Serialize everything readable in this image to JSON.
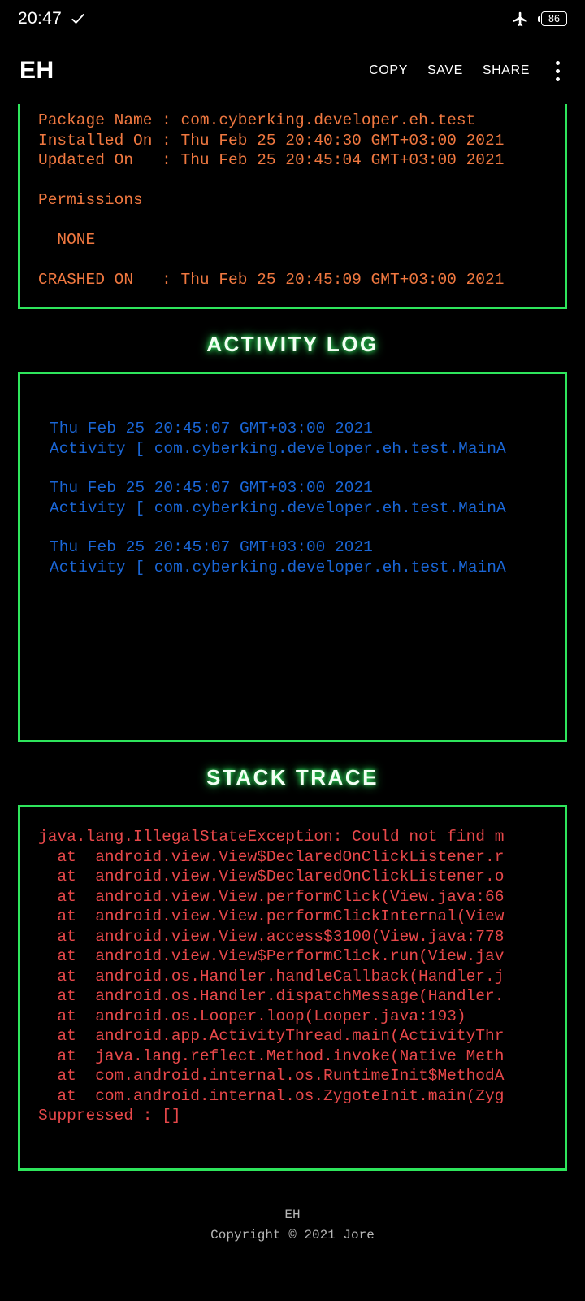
{
  "status_bar": {
    "clock": "20:47",
    "check_icon": "check-icon",
    "airplane_icon": "airplane-mode-icon",
    "battery_level": "86"
  },
  "app_bar": {
    "title": "EH",
    "actions": [
      {
        "label": "COPY",
        "name": "copy-button"
      },
      {
        "label": "SAVE",
        "name": "save-button"
      },
      {
        "label": "SHARE",
        "name": "share-button"
      }
    ],
    "overflow_icon": "overflow-menu-icon"
  },
  "info_panel": {
    "lines": [
      "Package Name : com.cyberking.developer.eh.test",
      "Installed On : Thu Feb 25 20:40:30 GMT+03:00 2021",
      "Updated On   : Thu Feb 25 20:45:04 GMT+03:00 2021"
    ],
    "permissions_label": "Permissions",
    "permissions_value": "  NONE",
    "crashed_line": "CRASHED ON   : Thu Feb 25 20:45:09 GMT+03:00 2021"
  },
  "activity_log": {
    "heading": "ACTIVITY LOG",
    "entries": [
      {
        "timestamp": "Thu Feb 25 20:45:07 GMT+03:00 2021",
        "detail": "Activity [ com.cyberking.developer.eh.test.MainA"
      },
      {
        "timestamp": "Thu Feb 25 20:45:07 GMT+03:00 2021",
        "detail": "Activity [ com.cyberking.developer.eh.test.MainA"
      },
      {
        "timestamp": "Thu Feb 25 20:45:07 GMT+03:00 2021",
        "detail": "Activity [ com.cyberking.developer.eh.test.MainA"
      }
    ]
  },
  "stack_trace": {
    "heading": "STACK TRACE",
    "lines": [
      "java.lang.IllegalStateException: Could not find m",
      "  at  android.view.View$DeclaredOnClickListener.r",
      "  at  android.view.View$DeclaredOnClickListener.o",
      "  at  android.view.View.performClick(View.java:66",
      "  at  android.view.View.performClickInternal(View",
      "  at  android.view.View.access$3100(View.java:778",
      "  at  android.view.View$PerformClick.run(View.jav",
      "  at  android.os.Handler.handleCallback(Handler.j",
      "  at  android.os.Handler.dispatchMessage(Handler.",
      "  at  android.os.Looper.loop(Looper.java:193)",
      "  at  android.app.ActivityThread.main(ActivityThr",
      "  at  java.lang.reflect.Method.invoke(Native Meth",
      "  at  com.android.internal.os.RuntimeInit$MethodA",
      "  at  com.android.internal.os.ZygoteInit.main(Zyg",
      "Suppressed : []"
    ]
  },
  "footer": {
    "app_name": "EH",
    "copyright": "Copyright © 2021 Jore"
  },
  "colors": {
    "accent_green": "#2EE55C",
    "info_orange": "#F07840",
    "log_blue": "#1A66D6",
    "trace_red": "#E8484A",
    "background": "#000000",
    "footer_gray": "#B6B6B6"
  }
}
